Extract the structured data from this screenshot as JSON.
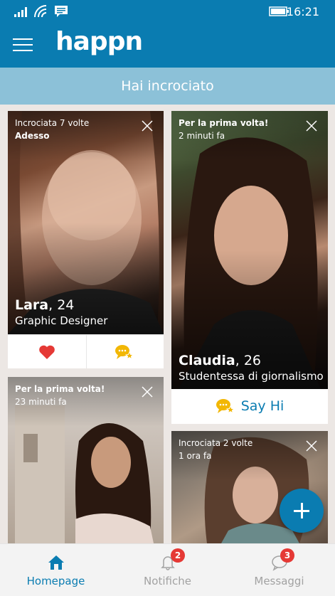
{
  "status_bar": {
    "time": "16:21"
  },
  "app": {
    "logo": "happn"
  },
  "subheader": {
    "title": "Hai incrociato"
  },
  "cards": [
    {
      "meta_line1": "Incrociata 7 volte",
      "meta_line2": "Adesso",
      "name": "Lara",
      "age": ", 24",
      "job": "Graphic Designer",
      "actions": [
        "heart-icon",
        "chat-star-icon"
      ]
    },
    {
      "meta_line1": "Per la prima volta!",
      "meta_line2": "2 minuti fa",
      "name": "Claudia",
      "age": ", 26",
      "job": "Studentessa di giornalismo",
      "cta": "Say Hi"
    },
    {
      "meta_line1": "Per la prima volta!",
      "meta_line2": "23 minuti fa"
    },
    {
      "meta_line1": "Incrociata 2 volte",
      "meta_line2": "1 ora fa"
    }
  ],
  "fab": {
    "icon": "plus-icon"
  },
  "bottom_nav": [
    {
      "label": "Homepage",
      "icon": "home-icon",
      "active": true
    },
    {
      "label": "Notifiche",
      "icon": "bell-icon",
      "badge": "2"
    },
    {
      "label": "Messaggi",
      "icon": "chat-icon",
      "badge": "3"
    }
  ],
  "colors": {
    "brand": "#0a7cb1",
    "subheader": "#8cc1d8",
    "heart": "#e53935",
    "chat_bubble": "#f2b705",
    "badge": "#e53935"
  }
}
